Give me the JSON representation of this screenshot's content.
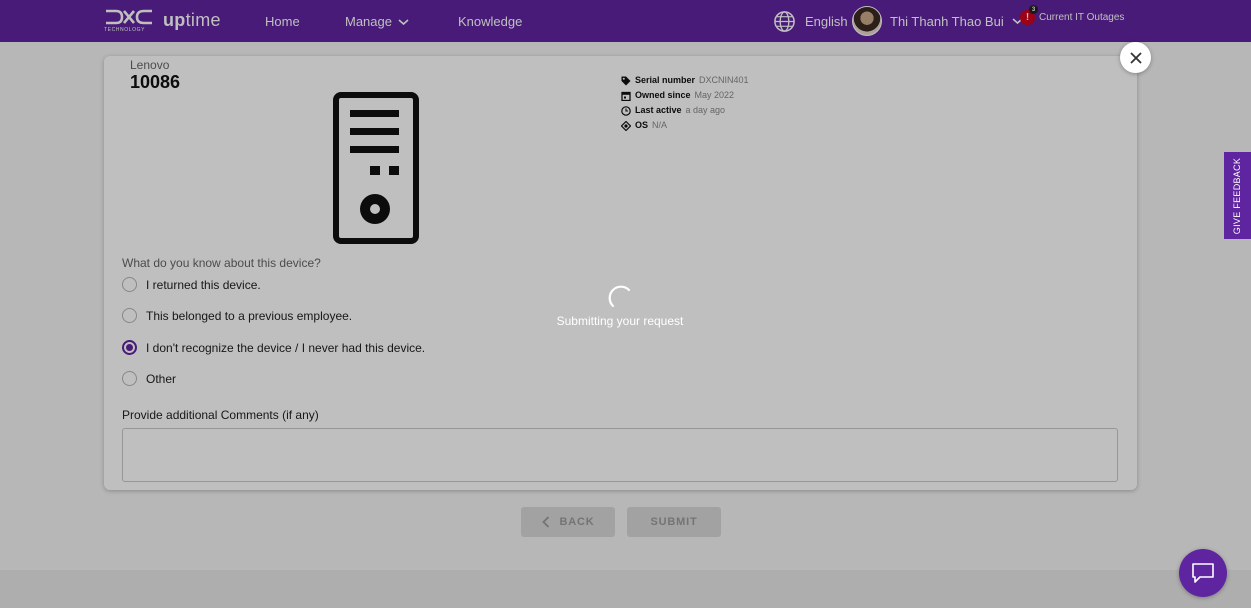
{
  "header": {
    "logo_sub": "TECHNOLOGY",
    "logo_up": "up",
    "logo_time": "time",
    "nav": [
      {
        "label": "Home"
      },
      {
        "label": "Manage"
      },
      {
        "label": "Knowledge"
      }
    ],
    "language": "English",
    "user_name": "Thi Thanh Thao Bui",
    "outage_count": "3",
    "outage_label": "Current IT Outages"
  },
  "device": {
    "brand": "Lenovo",
    "id": "10086",
    "icon": "desktop-tower-icon",
    "specs": [
      {
        "icon": "tag-icon",
        "label": "Serial number",
        "value": "DXCNIN401"
      },
      {
        "icon": "calendar-icon",
        "label": "Owned since",
        "value": "May 2022"
      },
      {
        "icon": "clock-icon",
        "label": "Last active",
        "value": "a day ago"
      },
      {
        "icon": "os-icon",
        "label": "OS",
        "value": "N/A"
      }
    ]
  },
  "form": {
    "question": "What do you know about this device?",
    "options": [
      {
        "label": "I returned this device.",
        "checked": false
      },
      {
        "label": "This belonged to a previous employee.",
        "checked": false
      },
      {
        "label": "I don't recognize the device / I never had this device.",
        "checked": true
      },
      {
        "label": "Other",
        "checked": false
      }
    ],
    "comments_label": "Provide additional Comments (if any)",
    "comments_value": "",
    "back_label": "BACK",
    "submit_label": "SUBMIT"
  },
  "loading": {
    "message": "Submitting your request"
  },
  "feedback_label": "GIVE FEEDBACK",
  "colors": {
    "brand_purple": "#5f249f",
    "alert_red": "#d0021b"
  }
}
